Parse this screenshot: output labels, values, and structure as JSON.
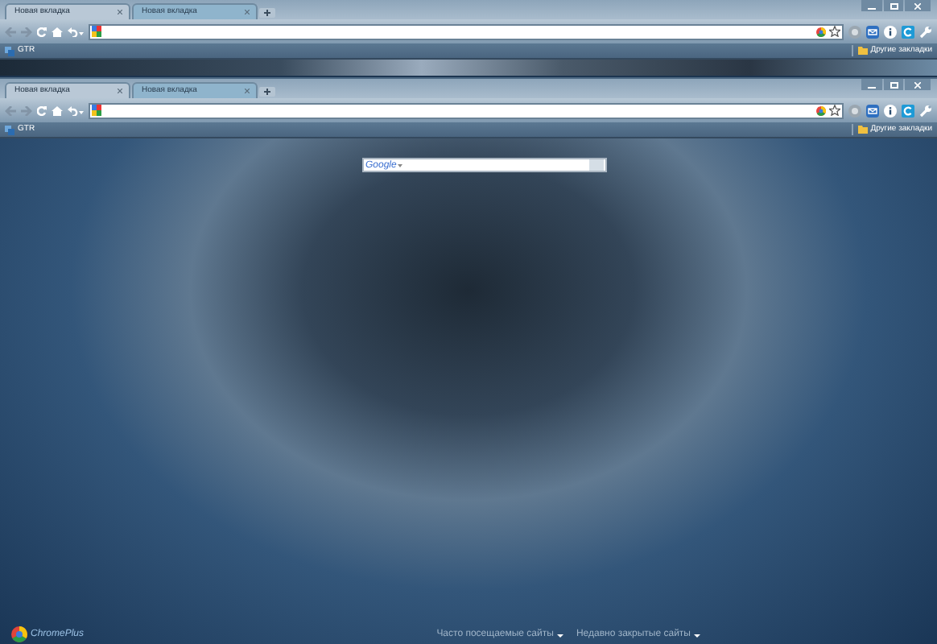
{
  "windows": [
    {
      "tabs": [
        {
          "label": "Новая вкладка",
          "selected": true
        },
        {
          "label": "Новая вкладка",
          "selected": false
        }
      ],
      "bookmarks": [
        {
          "label": "GTR"
        }
      ],
      "other_bookmarks": "Другие закладки"
    },
    {
      "tabs": [
        {
          "label": "Новая вкладка",
          "selected": true
        },
        {
          "label": "Новая вкладка",
          "selected": false
        }
      ],
      "bookmarks": [
        {
          "label": "GTR"
        }
      ],
      "other_bookmarks": "Другие закладки"
    }
  ],
  "new_tab_page": {
    "search": {
      "logo": "Google"
    },
    "brand": "ChromePlus",
    "links": [
      {
        "label": "Часто посещаемые сайты"
      },
      {
        "label": "Недавно закрытые сайты"
      }
    ]
  }
}
